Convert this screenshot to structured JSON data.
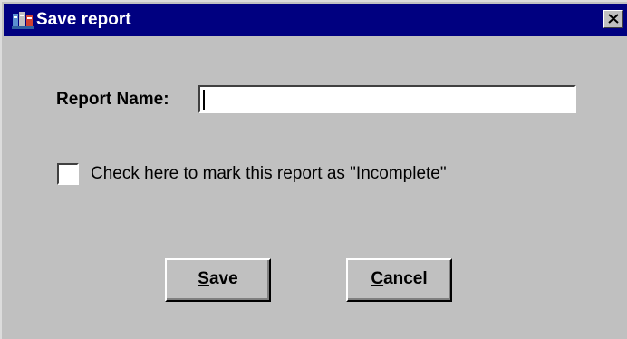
{
  "window": {
    "title": "Save report",
    "title_bar_color": "#000080",
    "body_color": "#c0c0c0",
    "icons": {
      "app": "report-app-icon",
      "close": "close-icon"
    }
  },
  "form": {
    "report_name_label": "Report Name:",
    "report_name_value": "",
    "incomplete_checkbox_checked": false,
    "incomplete_label": "Check here to mark this report as \"Incomplete\""
  },
  "buttons": {
    "save": {
      "mnemonic": "S",
      "rest": "ave"
    },
    "cancel": {
      "mnemonic": "C",
      "rest": "ancel"
    }
  }
}
